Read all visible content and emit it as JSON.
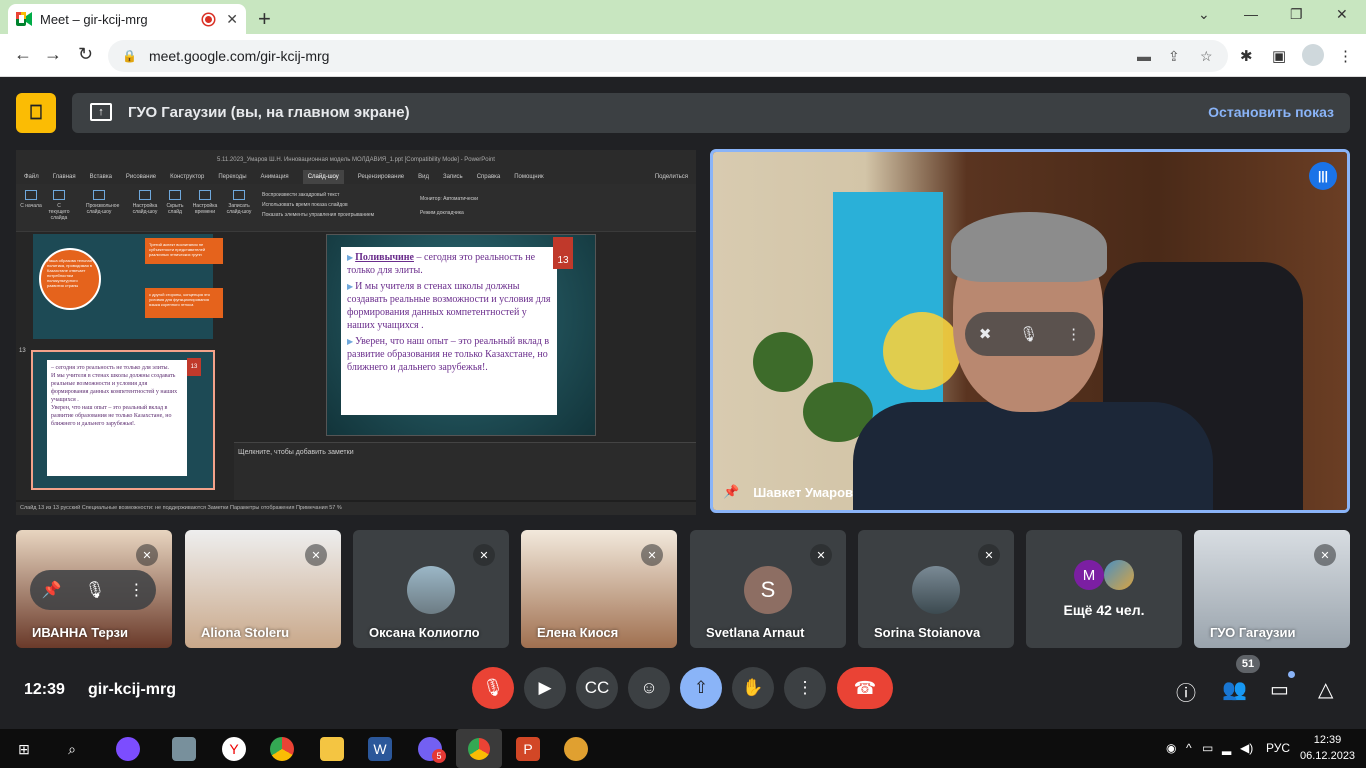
{
  "browser": {
    "tab_title": "Meet – gir-kcij-mrg",
    "new_tab": "+",
    "url": "meet.google.com/gir-kcij-mrg",
    "win_min": "⌄",
    "win_minimize": "—",
    "win_restore": "❐",
    "win_close": "✕"
  },
  "meet": {
    "banner_text": "ГУО Гагаузии (вы, на главном экране)",
    "stop_label": "Остановить показ",
    "presentation": {
      "window_title": "5.11.2023_Умаров Ш.Н. Инновационная модель МОЛДАВИЯ_1.ppt [Compatibility Mode] - PowerPoint",
      "menu": [
        "Файл",
        "Главная",
        "Вставка",
        "Рисование",
        "Конструктор",
        "Переходы",
        "Анимация",
        "Слайд-шоу",
        "Рецензирование",
        "Вид",
        "Запись",
        "Справка",
        "Помощник",
        "Поделиться"
      ],
      "ribbon": [
        "С начала",
        "С текущего слайда",
        "Произвольное слайд-шоу",
        "Настройка слайд-шоу",
        "Скрыть слайд",
        "Настройка времени",
        "Записать слайд-шоу"
      ],
      "ribbon_opts": [
        "Воспроизвести закадровый текст",
        "Использовать время показа слайдов",
        "Показать элементы управления проигрыванием",
        "Монитор: Автоматически",
        "Режим докладчика"
      ],
      "thumb1_text": "Наша образова тельная политика, проводимая в Казахстане отвечает потребностям поликультурного развития страны",
      "thumb1_r1": "Третий аспект воспитания не субъектности представителей различных этнических групп",
      "thumb1_r2": "с другой стороны, концепция это условия для функционирования языка коренного этноса",
      "thumb_num": "13",
      "slide_num": "13",
      "slide_lines": [
        "Поливычине",
        "– сегодня это реальность не только для элиты.",
        "И мы учителя в стенах школы должны создавать реальные возможности и условия для формирования данных компетентностей у наших учащихся .",
        "Уверен, что наш опыт – это реальный вклад в развитие образования не только Казахстане, но ближнего и дальнего зарубежья!."
      ],
      "notes": "Щелкните, чтобы добавить заметки",
      "status": "Слайд 13 из 13    русский    Специальные возможности: не поддерживаются                          Заметки   Параметры отображения   Примечания                                                  57 %"
    },
    "speaker_name": "Шавкет Умаров",
    "tiles": [
      {
        "name": "ИВАННА Терзи"
      },
      {
        "name": "Aliona Stoleru"
      },
      {
        "name": "Оксана Колиогло"
      },
      {
        "name": "Елена Киося"
      },
      {
        "name": "Svetlana Arnaut",
        "initial": "S"
      },
      {
        "name": "Sorina Stoianova"
      },
      {
        "name": "Ещё 42 чел.",
        "initial": "M"
      },
      {
        "name": "ГУО Гагаузии"
      }
    ],
    "time": "12:39",
    "meeting_code": "gir-kcij-mrg",
    "participants_count": "51"
  },
  "taskbar": {
    "lang": "РУС",
    "time": "12:39",
    "date": "06.12.2023",
    "viber_badge": "5"
  },
  "colors": {
    "accent": "#8ab4f8",
    "red": "#ea4335",
    "meet_bg": "#202124"
  }
}
